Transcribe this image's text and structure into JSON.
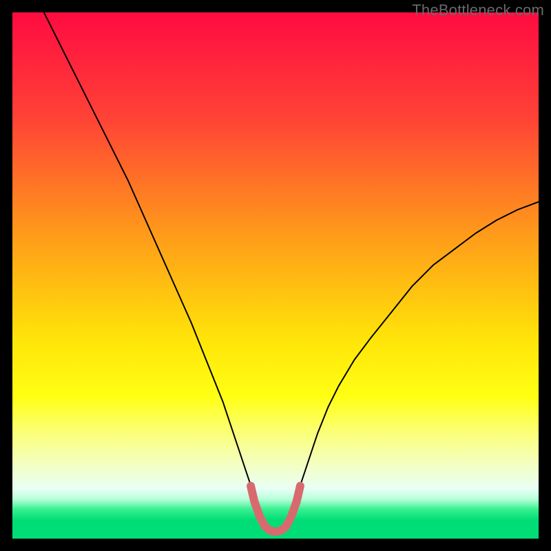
{
  "watermark": "TheBottleneck.com",
  "chart_data": {
    "type": "line",
    "title": "",
    "xlabel": "",
    "ylabel": "",
    "xlim": [
      0,
      100
    ],
    "ylim": [
      0,
      100
    ],
    "background_gradient": {
      "stops": [
        {
          "pos": 0.0,
          "color": "#ff0b41"
        },
        {
          "pos": 0.2,
          "color": "#ff4236"
        },
        {
          "pos": 0.42,
          "color": "#ff9a1a"
        },
        {
          "pos": 0.62,
          "color": "#ffe409"
        },
        {
          "pos": 0.73,
          "color": "#ffff13"
        },
        {
          "pos": 0.8,
          "color": "#fbff7a"
        },
        {
          "pos": 0.86,
          "color": "#f3ffc3"
        },
        {
          "pos": 0.905,
          "color": "#e9fff6"
        },
        {
          "pos": 0.925,
          "color": "#b7ffda"
        },
        {
          "pos": 0.945,
          "color": "#34f08e"
        },
        {
          "pos": 0.965,
          "color": "#00dd77"
        },
        {
          "pos": 1.0,
          "color": "#00dd77"
        }
      ]
    },
    "series": [
      {
        "name": "bottleneck-curve",
        "stroke": "#000000",
        "stroke_width": 2,
        "x": [
          6,
          10,
          14,
          18,
          22,
          26,
          30,
          34,
          36,
          38,
          40,
          41,
          42,
          43,
          44,
          45,
          46,
          47,
          48,
          49,
          50,
          51,
          52,
          53,
          54,
          55,
          56,
          57,
          58,
          60,
          62,
          65,
          68,
          72,
          76,
          80,
          84,
          88,
          92,
          96,
          100
        ],
        "y": [
          100,
          92,
          84,
          76,
          68,
          59,
          50,
          41,
          36,
          31,
          26,
          23,
          20,
          17,
          14,
          11,
          8.2,
          5.5,
          3.3,
          2.1,
          1.7,
          2.1,
          3.3,
          5.5,
          8.2,
          11,
          14,
          17,
          20,
          25,
          29,
          34,
          38,
          43,
          48,
          52,
          55,
          58,
          60.5,
          62.5,
          64
        ]
      },
      {
        "name": "optimal-zone-marker",
        "stroke": "#d86a6f",
        "stroke_width": 12,
        "linecap": "round",
        "x": [
          45.3,
          46.0,
          47.0,
          48.0,
          49.0,
          50.0,
          51.0,
          52.0,
          53.0,
          54.0,
          54.7
        ],
        "y": [
          10.0,
          7.0,
          4.2,
          2.3,
          1.5,
          1.3,
          1.5,
          2.3,
          4.2,
          7.0,
          10.0
        ]
      }
    ]
  }
}
